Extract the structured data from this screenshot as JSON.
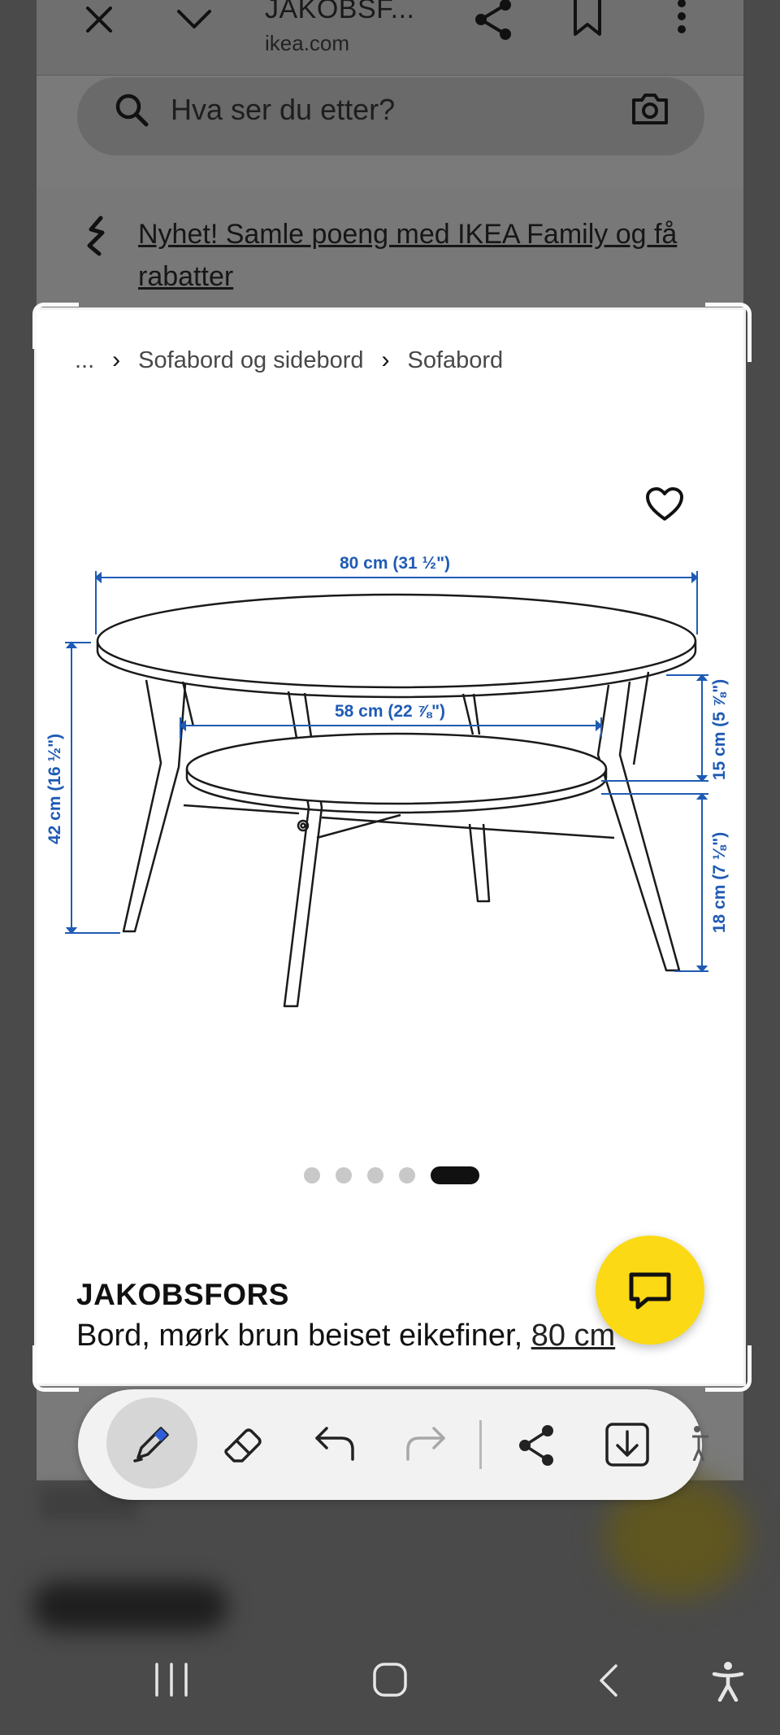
{
  "browser": {
    "title": "JAKOBSF...",
    "url": "ikea.com",
    "search_placeholder": "Hva ser du etter?",
    "promo": "Nyhet! Samle poeng med IKEA Family og få rabatter"
  },
  "breadcrumb": {
    "ellipsis": "...",
    "items": [
      "Sofabord og sidebord",
      "Sofabord"
    ]
  },
  "diagram": {
    "width_label": "80 cm (31 ½\")",
    "shelf_label": "58 cm (22 ⅞\")",
    "height_label": "42 cm (16 ½\")",
    "upper_gap_label": "15 cm (5 ⅞\")",
    "lower_gap_label": "18 cm (7 ⅛\")",
    "dimension_color": "#1f5bb4"
  },
  "carousel": {
    "total": 5,
    "active": 5
  },
  "product": {
    "name": "JAKOBSFORS",
    "description": "Bord, mørk brun beiset eikefiner, ",
    "size_link": "80 cm"
  },
  "toolbar": {
    "tools": [
      "pen-icon",
      "eraser-icon",
      "undo-icon",
      "redo-icon",
      "share-icon",
      "download-icon"
    ]
  },
  "colors": {
    "accent_yellow": "#fbd914",
    "pen_blue": "#2f5fd8"
  }
}
